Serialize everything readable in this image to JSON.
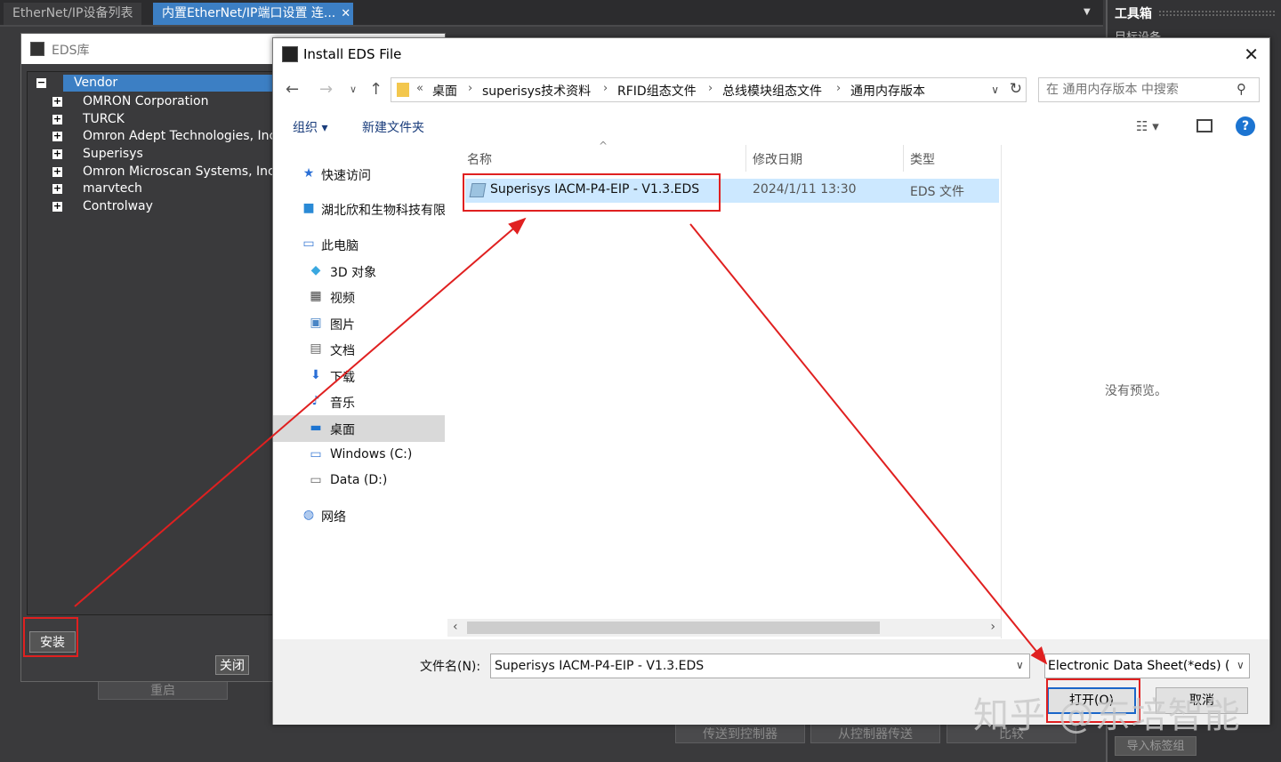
{
  "tabs": [
    {
      "label": "EtherNet/IP设备列表"
    },
    {
      "label": "内置EtherNet/IP端口设置 连..."
    }
  ],
  "tab_close_glyph": "✕",
  "toolbox": {
    "title": "工具箱",
    "subtitle": "目标设备",
    "import_label": "导入标签组"
  },
  "background_buttons": {
    "restart": "重启",
    "to_controller": "传送到控制器",
    "from_controller": "从控制器传送",
    "compare": "比较"
  },
  "eds_library": {
    "title": "EDS库",
    "root": "Vendor",
    "vendors": [
      "OMRON Corporation",
      "TURCK",
      "Omron Adept Technologies, Inc.",
      "Superisys",
      "Omron Microscan Systems, Inc.",
      "marvtech",
      "Controlway"
    ],
    "install_label": "安装",
    "close_label": "关闭"
  },
  "dialog": {
    "title": "Install EDS File",
    "close_glyph": "✕",
    "breadcrumb": [
      "桌面",
      "superisys技术资料",
      "RFID组态文件",
      "总线模块组态文件",
      "通用内存版本"
    ],
    "search_placeholder": "在 通用内存版本 中搜索",
    "organize_label": "组织 ▾",
    "new_folder_label": "新建文件夹",
    "nav_items": [
      {
        "label": "快速访问",
        "icon": "star-icon"
      },
      {
        "label": "湖北欣和生物科技有限",
        "icon": "cloud-folder-icon"
      },
      {
        "label": "此电脑",
        "icon": "computer-icon"
      },
      {
        "label": "3D 对象",
        "icon": "cube-icon"
      },
      {
        "label": "视频",
        "icon": "video-icon"
      },
      {
        "label": "图片",
        "icon": "picture-icon"
      },
      {
        "label": "文档",
        "icon": "document-icon"
      },
      {
        "label": "下载",
        "icon": "download-icon"
      },
      {
        "label": "音乐",
        "icon": "music-icon"
      },
      {
        "label": "桌面",
        "icon": "desktop-icon",
        "selected": true
      },
      {
        "label": "Windows (C:)",
        "icon": "drive-c-icon"
      },
      {
        "label": "Data (D:)",
        "icon": "drive-d-icon"
      },
      {
        "label": "网络",
        "icon": "network-icon"
      }
    ],
    "columns": {
      "name": "名称",
      "date": "修改日期",
      "type": "类型"
    },
    "files": [
      {
        "name": "Superisys IACM-P4-EIP - V1.3.EDS",
        "date": "2024/1/11 13:30",
        "type": "EDS 文件"
      }
    ],
    "preview_text": "没有预览。",
    "filename_label": "文件名(N):",
    "filename_value": "Superisys IACM-P4-EIP - V1.3.EDS",
    "filetype_value": "Electronic Data Sheet(*eds) (",
    "open_label": "打开(O)",
    "cancel_label": "取消"
  },
  "watermark": "知乎 @东培智能",
  "colors": {
    "accent": "#3c7fc4",
    "annotation": "#e02020",
    "selection": "#cce8ff"
  }
}
